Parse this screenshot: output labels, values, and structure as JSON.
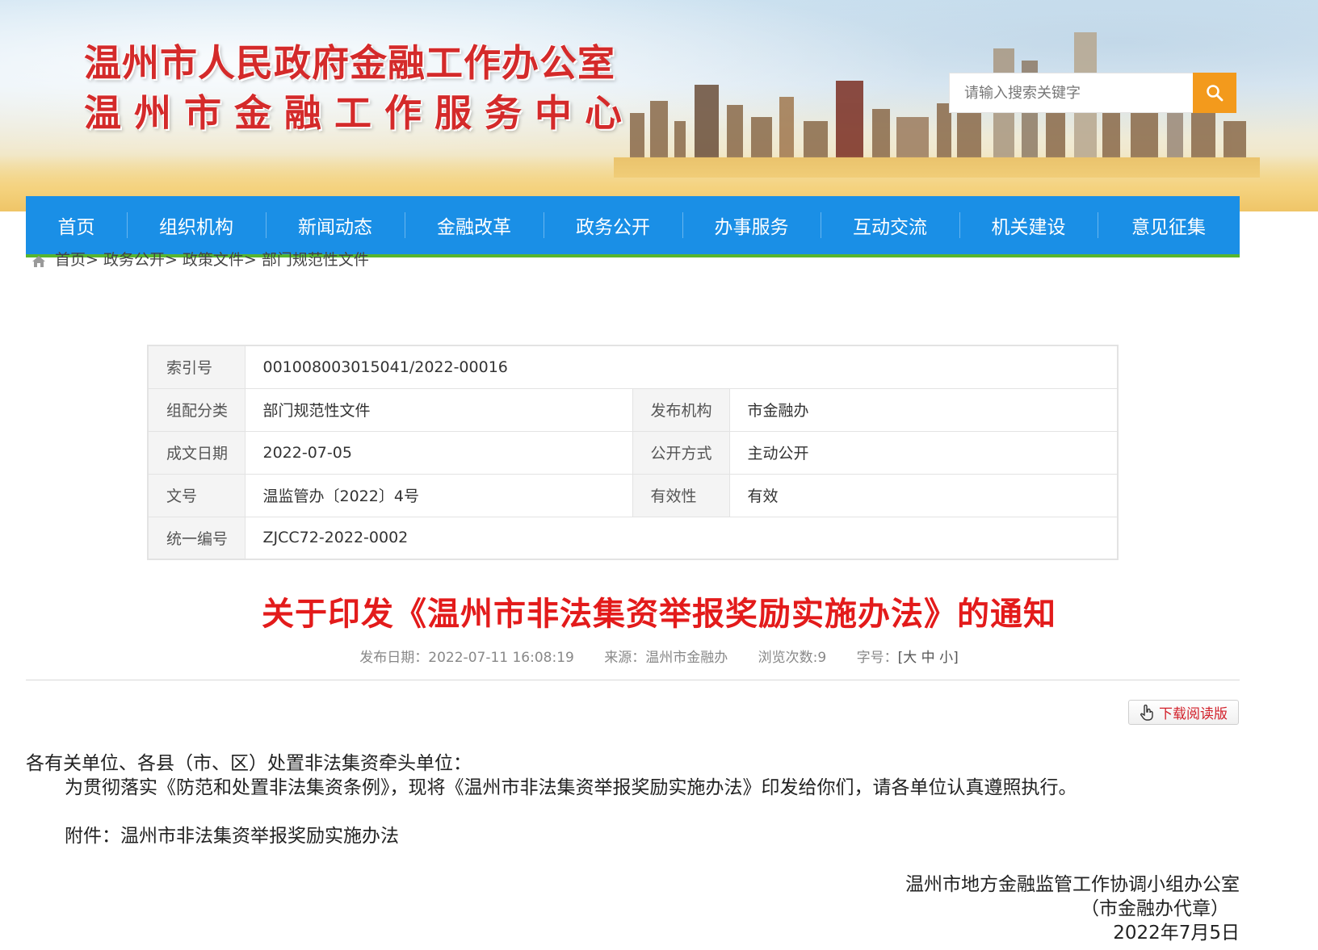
{
  "header": {
    "title_line1": "温州市人民政府金融工作办公室",
    "title_line2": "温州市金融工作服务中心",
    "search_placeholder": "请输入搜索关键字",
    "search_icon": "search-icon"
  },
  "nav": {
    "items": [
      "首页",
      "组织机构",
      "新闻动态",
      "金融改革",
      "政务公开",
      "办事服务",
      "互动交流",
      "机关建设",
      "意见征集"
    ]
  },
  "breadcrumb": {
    "icon": "home-icon",
    "text": "首页> 政务公开> 政策文件> 部门规范性文件"
  },
  "info_table": {
    "index_label": "索引号",
    "index_value": "001008003015041/2022-00016",
    "category_label": "组配分类",
    "category_value": "部门规范性文件",
    "publisher_label": "发布机构",
    "publisher_value": "市金融办",
    "date_label": "成文日期",
    "date_value": "2022-07-05",
    "open_label": "公开方式",
    "open_value": "主动公开",
    "docno_label": "文号",
    "docno_value": "温监管办〔2022〕4号",
    "validity_label": "有效性",
    "validity_value": "有效",
    "code_label": "统一编号",
    "code_value": "ZJCC72-2022-0002"
  },
  "article": {
    "title": "关于印发《温州市非法集资举报奖励实施办法》的通知",
    "publish_date": "发布日期：2022-07-11 16:08:19",
    "source": "来源：温州市金融办",
    "views": "浏览次数:9",
    "font_size_label": "字号：",
    "font_size_options": "[大 中 小]",
    "download_label": "下载阅读版",
    "download_icon": "hand-pointer-icon",
    "salutation": "各有关单位、各县（市、区）处置非法集资牵头单位：",
    "paragraph1": "为贯彻落实《防范和处置非法集资条例》，现将《温州市非法集资举报奖励实施办法》印发给你们，请各单位认真遵照执行。",
    "attachment": "附件：温州市非法集资举报奖励实施办法",
    "sign_org": "温州市地方金融监管工作协调小组办公室",
    "sign_seal": "（市金融办代章）",
    "sign_date": "2022年7月5日"
  },
  "colors": {
    "nav_blue": "#1a8fe6",
    "nav_accent_green": "#58b52e",
    "title_red": "#e31b1b",
    "search_orange": "#f39a1c"
  }
}
